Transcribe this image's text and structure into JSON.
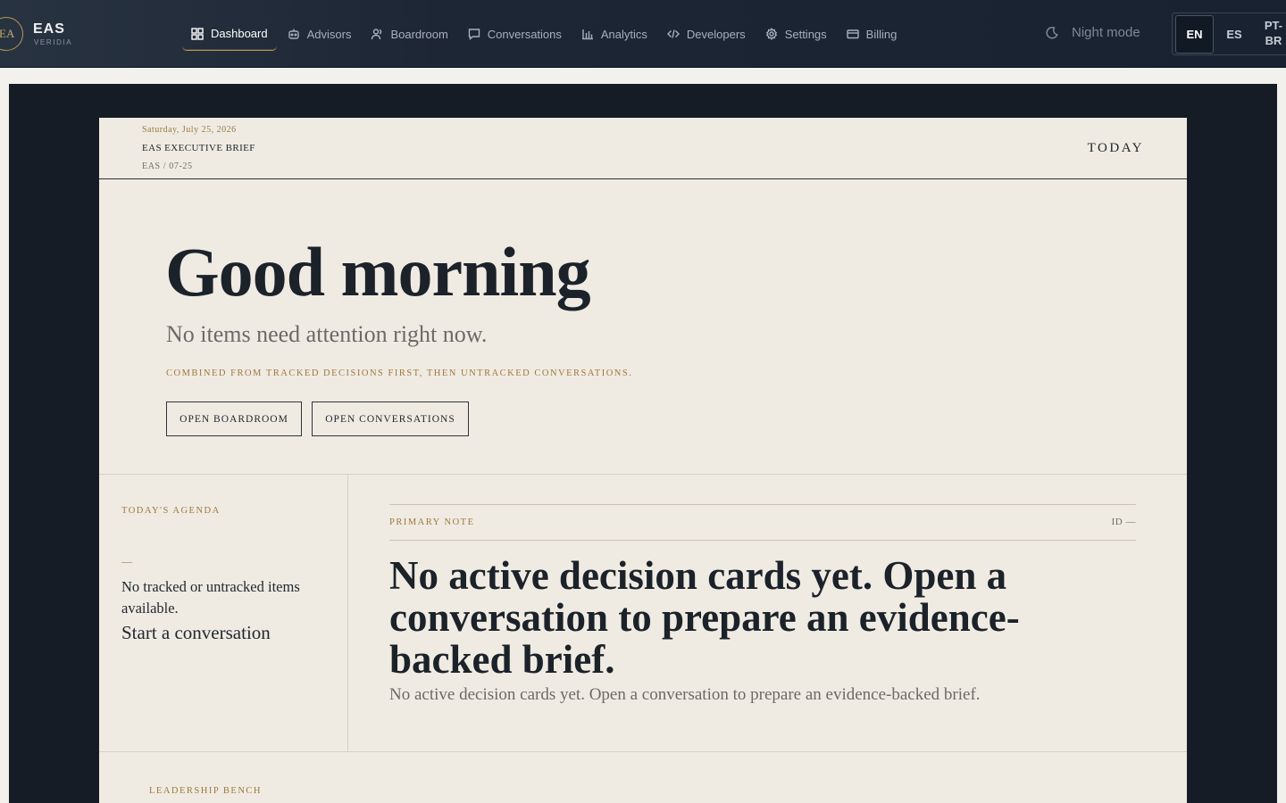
{
  "brand": {
    "ring": "EA",
    "name": "EAS",
    "sub": "VERIDIA"
  },
  "nav": [
    {
      "label": "Dashboard",
      "icon": "grid-icon",
      "active": true
    },
    {
      "label": "Advisors",
      "icon": "robot-icon"
    },
    {
      "label": "Boardroom",
      "icon": "users-icon"
    },
    {
      "label": "Conversations",
      "icon": "chat-icon"
    },
    {
      "label": "Analytics",
      "icon": "bar-chart-icon"
    },
    {
      "label": "Developers",
      "icon": "code-icon"
    },
    {
      "label": "Settings",
      "icon": "gear-icon"
    },
    {
      "label": "Billing",
      "icon": "card-icon"
    }
  ],
  "night_mode": "Night mode",
  "languages": {
    "en": "EN",
    "es": "ES",
    "pt_line1": "PT-",
    "pt_line2": "BR"
  },
  "masthead": {
    "date": "Saturday, July 25, 2026",
    "title": "EAS EXECUTIVE BRIEF",
    "code": "EAS / 07-25",
    "today": "TODAY"
  },
  "hero": {
    "greeting": "Good morning",
    "attention": "No items need attention right now.",
    "combined": "COMBINED FROM TRACKED DECISIONS FIRST, THEN UNTRACKED CONVERSATIONS.",
    "open_boardroom": "OPEN BOARDROOM",
    "open_conversations": "OPEN CONVERSATIONS"
  },
  "agenda": {
    "label": "TODAY'S AGENDA",
    "dash": "—",
    "empty": "No tracked or untracked items available.",
    "start": "Start a conversation"
  },
  "note": {
    "label": "PRIMARY NOTE",
    "id": "ID —",
    "headline": "No active decision cards yet. Open a conversation to prepare an evidence-backed brief.",
    "body": "No active decision cards yet. Open a conversation to prepare an evidence-backed brief."
  },
  "bench": {
    "label": "LEADERSHIP BENCH"
  },
  "colors": {
    "accent": "#b59556",
    "navy": "#1d2634",
    "paper": "#efebe3"
  }
}
